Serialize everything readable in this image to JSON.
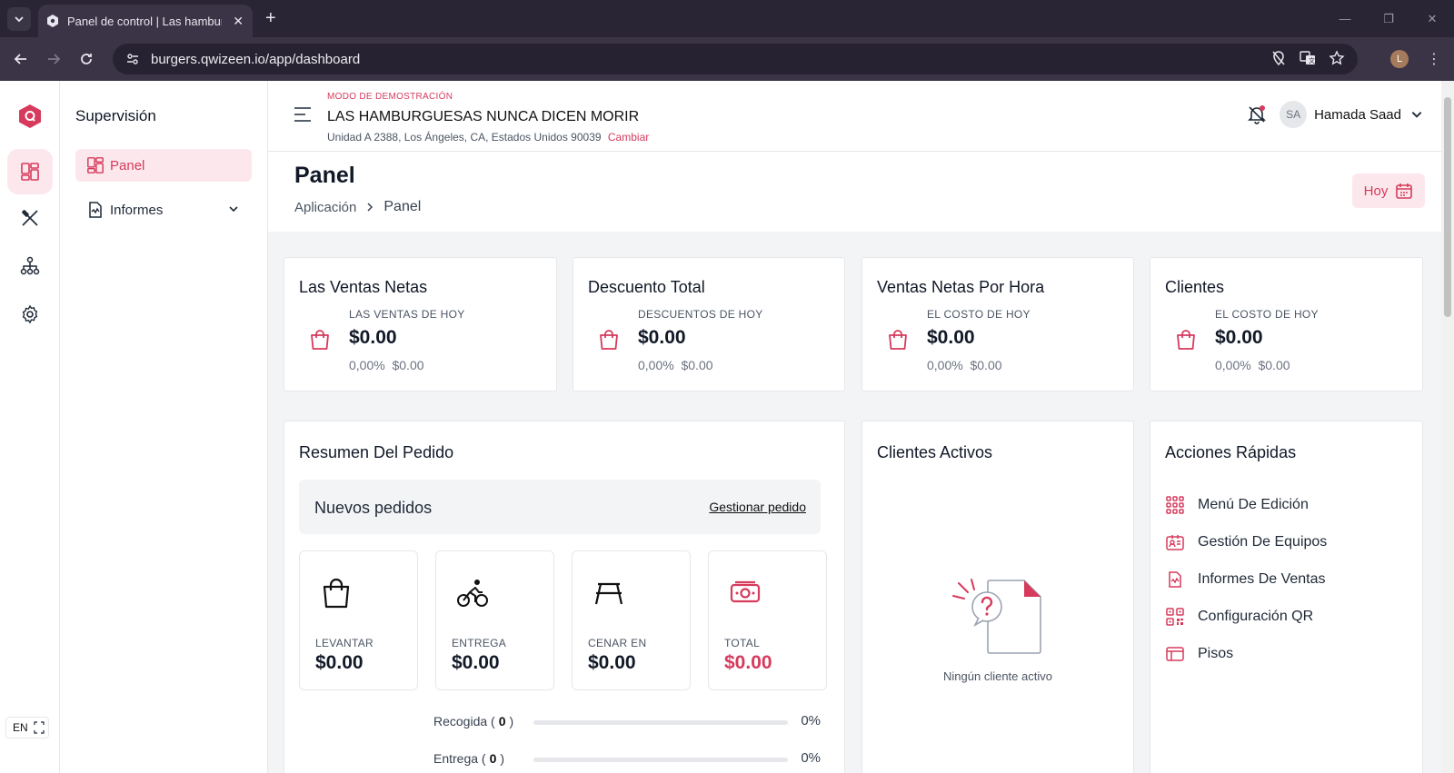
{
  "browser": {
    "tab_title": "Panel de control | Las hamburguesas nunca dicen morir",
    "url": "burgers.qwizeen.io/app/dashboard",
    "profile_initial": "L"
  },
  "sidenav": {
    "title": "Supervisión",
    "items": [
      {
        "label": "Panel",
        "active": true
      },
      {
        "label": "Informes",
        "active": false
      }
    ],
    "language": "EN"
  },
  "header": {
    "demo_tag": "MODO DE DEMOSTRACIÓN",
    "store_name": "LAS HAMBURGUESAS NUNCA DICEN MORIR",
    "store_address": "Unidad A 2388, Los Ángeles, CA, Estados Unidos 90039",
    "change_link": "Cambiar",
    "user_initials": "SA",
    "user_name": "Hamada Saad"
  },
  "page": {
    "title": "Panel",
    "breadcrumb": [
      "Aplicación",
      "Panel"
    ],
    "date_button": "Hoy"
  },
  "stats": [
    {
      "title": "Las Ventas Netas",
      "caption": "LAS VENTAS DE HOY",
      "value": "$0.00",
      "pct": "0,00%",
      "delta": "$0.00"
    },
    {
      "title": "Descuento Total",
      "caption": "DESCUENTOS DE HOY",
      "value": "$0.00",
      "pct": "0,00%",
      "delta": "$0.00"
    },
    {
      "title": "Ventas Netas Por Hora",
      "caption": "EL COSTO DE HOY",
      "value": "$0.00",
      "pct": "0,00%",
      "delta": "$0.00"
    },
    {
      "title": "Clientes",
      "caption": "EL COSTO DE HOY",
      "value": "$0.00",
      "pct": "0,00%",
      "delta": "$0.00"
    }
  ],
  "order_summary": {
    "title": "Resumen Del Pedido",
    "new_orders_label": "Nuevos pedidos",
    "manage_link": "Gestionar pedido",
    "tiles": [
      {
        "label": "LEVANTAR",
        "value": "$0.00",
        "icon": "shopping-bag-icon"
      },
      {
        "label": "ENTREGA",
        "value": "$0.00",
        "icon": "bicycle-icon"
      },
      {
        "label": "CENAR EN",
        "value": "$0.00",
        "icon": "table-icon"
      },
      {
        "label": "TOTAL",
        "value": "$0.00",
        "icon": "money-icon"
      }
    ],
    "progress": [
      {
        "label": "Recogida",
        "count": "0",
        "pct": "0%",
        "fraction": 0
      },
      {
        "label": "Entrega",
        "count": "0",
        "pct": "0%",
        "fraction": 0
      }
    ]
  },
  "active_clients": {
    "title": "Clientes Activos",
    "empty_text": "Ningún cliente activo"
  },
  "quick_actions": {
    "title": "Acciones Rápidas",
    "items": [
      {
        "label": "Menú De Edición",
        "icon": "grid-icon"
      },
      {
        "label": "Gestión De Equipos",
        "icon": "id-card-icon"
      },
      {
        "label": "Informes De Ventas",
        "icon": "report-icon"
      },
      {
        "label": "Configuración QR",
        "icon": "qr-icon"
      },
      {
        "label": "Pisos",
        "icon": "floor-icon"
      }
    ]
  },
  "colors": {
    "accent": "#d63a5c",
    "accent_soft": "#fce8ec"
  }
}
